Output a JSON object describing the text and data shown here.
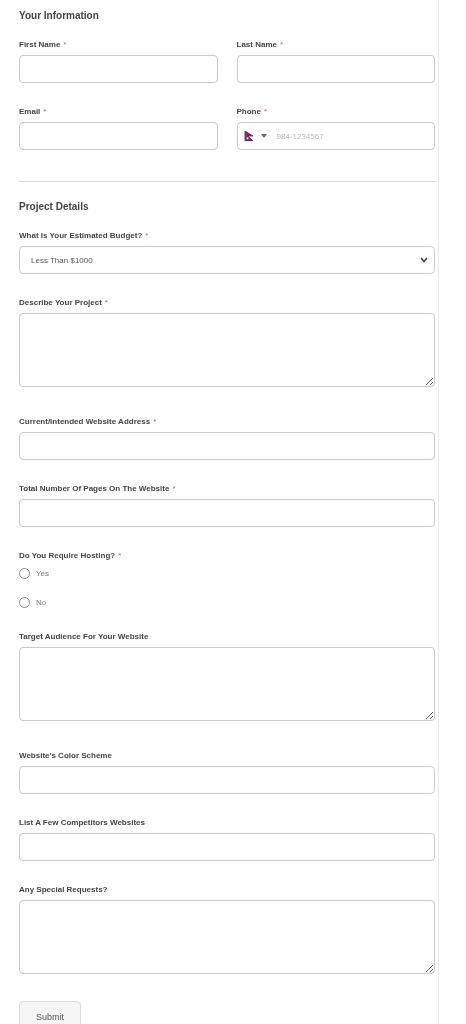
{
  "sections": [
    {
      "title": "Your Information",
      "rows": [
        [
          {
            "kind": "text",
            "label": "First Name",
            "mark": "*"
          },
          {
            "kind": "text",
            "label": "Last Name",
            "mark": "*"
          }
        ],
        [
          {
            "kind": "text",
            "label": "Email",
            "mark": "*"
          },
          {
            "kind": "phone",
            "label": "Phone",
            "mark": "*",
            "placeholder": "984-1234567"
          }
        ]
      ]
    },
    {
      "title": "Project Details",
      "rows": [
        [
          {
            "kind": "select",
            "label": "What Is Your Estimated Budget?",
            "mark": "*",
            "value": "Less Than $1000"
          }
        ],
        [
          {
            "kind": "textarea",
            "label": "Describe Your Project",
            "mark": "*"
          }
        ],
        [
          {
            "kind": "text",
            "label": "Current/Intended Website Address",
            "mark": "*"
          }
        ],
        [
          {
            "kind": "text",
            "label": "Total Number Of Pages On The Website",
            "mark": "*"
          }
        ],
        [
          {
            "kind": "radio",
            "label": "Do You Require Hosting?",
            "mark": "*",
            "options": [
              {
                "label": "Yes",
                "selected": false
              },
              {
                "label": "No",
                "selected": false
              }
            ]
          }
        ],
        [
          {
            "kind": "textarea",
            "label": "Target Audience For Your Website"
          }
        ],
        [
          {
            "kind": "text",
            "label": "Website's Color Scheme"
          }
        ],
        [
          {
            "kind": "text",
            "label": "List A Few Competitors Websites"
          }
        ],
        [
          {
            "kind": "textarea",
            "label": "Any Special Requests?"
          }
        ]
      ]
    }
  ],
  "submit": "Submit"
}
